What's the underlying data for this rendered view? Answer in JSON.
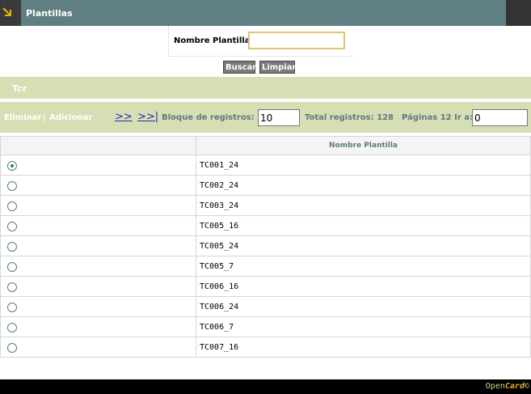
{
  "header": {
    "title": "Plantillas",
    "icon": "arrow-down-right-icon"
  },
  "search": {
    "label": "Nombre Plantilla",
    "value": "",
    "buscar_label": "Buscar",
    "limpiar_label": "Limpiar"
  },
  "band": {
    "label": "Tcr"
  },
  "toolbar": {
    "eliminar_label": "Eliminar",
    "separator": "|",
    "adicionar_label": "Adicionar",
    "next_label": ">>",
    "last_label": ">>|",
    "bloque_label": "Bloque de registros:",
    "bloque_value": "10",
    "total_label": "Total registros: 128",
    "paginas_label": "Páginas 12 Ir a:",
    "goto_value": "0"
  },
  "table": {
    "column_header": "Nombre Plantilla",
    "rows": [
      {
        "name": "TC001_24",
        "selected": true
      },
      {
        "name": "TC002_24",
        "selected": false
      },
      {
        "name": "TC003_24",
        "selected": false
      },
      {
        "name": "TC005_16",
        "selected": false
      },
      {
        "name": "TC005_24",
        "selected": false
      },
      {
        "name": "TC005_7",
        "selected": false
      },
      {
        "name": "TC006_16",
        "selected": false
      },
      {
        "name": "TC006_24",
        "selected": false
      },
      {
        "name": "TC006_7",
        "selected": false
      },
      {
        "name": "TC007_16",
        "selected": false
      }
    ]
  },
  "footer": {
    "logo_prefix": "Open",
    "logo_accent": "Card",
    "logo_suffix": "©"
  },
  "colors": {
    "header_bg": "#5f7f83",
    "band_bg": "#d6dfb4",
    "input_focus_border": "#e0c27a",
    "link_blue": "#1a2fb0"
  }
}
